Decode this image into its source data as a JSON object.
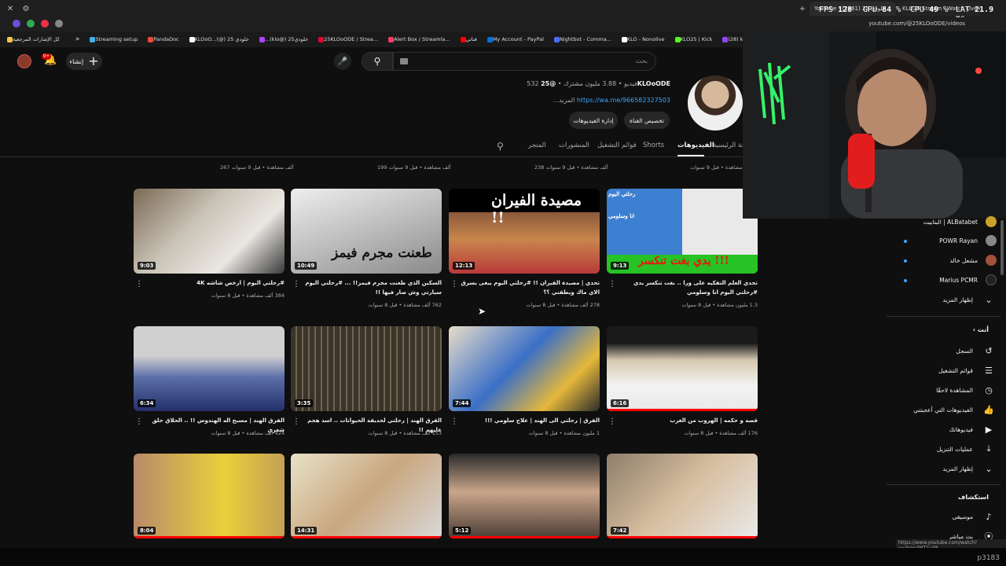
{
  "browser": {
    "active_tab": "YouTube - خلودي 25 (2861)",
    "stream_tab": "KLO25 Stream - Watch Live on",
    "url": "youtube.com/@25KLOoODE/videos",
    "status_url": "https://www.youtube.com/watch?v=Yeon3MT1u38",
    "bookmarks": [
      "كل الإشارات المرجعية",
      "Streaming setup",
      "PandaDoc",
      "KLOoO...(@) خلودي 25",
      "...(klo@) خلودي25",
      "25KLOoODE / Strea...",
      "Alert Box / Streamla...",
      "قناتي",
      "My Account - PayPal",
      "Nightbot - Comma...",
      "KLO - Nonolive",
      "KLO25 | Kick",
      "(28) klo25 - Twitch"
    ]
  },
  "stats": {
    "fps_label": "FPS",
    "fps": "128",
    "gpu_label": "GPU",
    "gpu": "84",
    "cpu_label": "CPU",
    "cpu": "49",
    "lat_label": "LAT",
    "lat": "21.9",
    "pct": "%",
    "ms": "ms"
  },
  "header": {
    "create_label": "إنشاء",
    "notif_count": "9+",
    "search_placeholder": "بحث"
  },
  "channel": {
    "handle": "@25KLOoODE",
    "subs": "3.88 مليون مشترك",
    "videos_count": "532 فيديو",
    "meta_sep": " • ",
    "link": "https://wa.me/966582327503",
    "more": " ...المزيد",
    "customize_label": "تخصيص القناة",
    "manage_label": "إدارة الفيديوهات"
  },
  "tabs": [
    "الصفحة الرئيسية",
    "الفيديوهات",
    "Shorts",
    "قوائم التشغيل",
    "المنشورات",
    "المتجر"
  ],
  "partial_row": [
    {
      "meta": "267 ألف مشاهدة • قبل 9 سنوات"
    },
    {
      "meta": "199 ألف مشاهدة • قبل 9 سنوات"
    },
    {
      "meta": "238 ألف مشاهدة • قبل 9 سنوات"
    },
    {
      "meta": "مليون مشاهدة • قبل 9 سنوات"
    }
  ],
  "videos": [
    {
      "title": "#رحلتي اليوم | ارخص شاشه 4K",
      "meta": "384 ألف مشاهدة • قبل 8 سنوات",
      "duration": "9:03"
    },
    {
      "title": "السكين الذي طعنت مجرم فيمز!! ... #رحلتي اليوم سيارتي وش صار فيها !!",
      "meta": "762 ألف مشاهدة • قبل 8 سنوات",
      "duration": "10:49",
      "caption": "طعنت مجرم فيمز"
    },
    {
      "title": "تحدي | مصيدة الفيران !! #رحلتي اليوم يبغى يسرق الاي ماك ويطقني ؟؟",
      "meta": "278 ألف مشاهدة • قبل 8 سنوات",
      "duration": "12:13",
      "caption": "مصيدة الفيران !!"
    },
    {
      "title": "تحدي العلم التفكيه على ورا .. بغت تنكسر يدي #رحلتي اليوم انا وسلومي",
      "meta": "1.3 مليون مشاهدة • قبل 8 سنوات",
      "duration": "9:13",
      "caption": "يدي بغت تنكسر !!!",
      "caption2": "رحلتي اليوم",
      "caption3": "انا وسلومي"
    },
    {
      "title": "الفرق الهند | رحلتي لحديقة الحيوانات .. اسد هجم عليهم !!",
      "meta": "424 ألف مشاهدة • قبل 8 سنوات",
      "duration": "6:34",
      "_swap": true
    },
    {
      "title": "الفرق الهند | رحلتي لحديقة الحيوانات .. اسد هجم عليهم !!",
      "meta": "153 ألف مشاهدة • قبل 8 سنوات",
      "duration": "3:35"
    },
    {
      "title": "الفرق | رحلتي الى الهند | علاج سلومي !!!",
      "meta": "1 مليون مشاهدة • قبل 8 سنوات",
      "duration": "7:44"
    },
    {
      "title": "قصه و حكمه | الهروب من الغرب",
      "meta": "176 ألف مشاهدة • قبل 8 سنوات",
      "duration": "6:16"
    },
    {
      "duration": "8:04"
    },
    {
      "duration": "14:31"
    },
    {
      "duration": "5:12"
    },
    {
      "duration": "7:42"
    }
  ],
  "video_titles_fix": {
    "row2_col1": "الفرق الهند | مسبح اله الهندوس !! .. الحلاق حلق شعري"
  },
  "sidebar": {
    "subscriptions": [
      {
        "name": "البتابيت | ALBatabet"
      },
      {
        "name": "POWR Rayan"
      },
      {
        "name": "مشعل خالد"
      },
      {
        "name": "Marius PCMR"
      }
    ],
    "show_more": "إظهار المزيد",
    "you_label": "أنت",
    "you_items": [
      "السجل",
      "قوائم التشغيل",
      "المشاهدة لاحقًا",
      "الفيديوهات التي أعجبتني",
      "فيديوهاتك",
      "عمليات التنزيل"
    ],
    "explore_label": "استكشاف",
    "explore_items": [
      "موسيقى",
      "بث مباشر"
    ]
  },
  "overlay_text": "p3183",
  "colors": {
    "accent": "#ff0000",
    "link": "#3ea6ff",
    "bg": "#0f0f0f"
  }
}
